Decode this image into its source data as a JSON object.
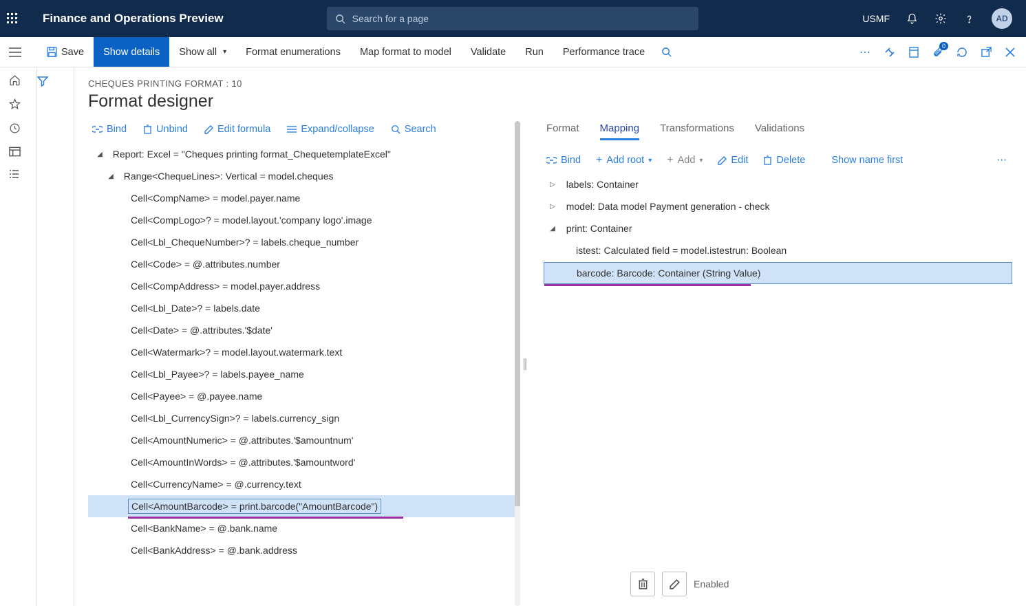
{
  "topbar": {
    "brand": "Finance and Operations Preview",
    "search_placeholder": "Search for a page",
    "entity": "USMF",
    "avatar": "AD"
  },
  "actions": {
    "save": "Save",
    "show_details": "Show details",
    "show_all": "Show all",
    "format_enum": "Format enumerations",
    "map_format": "Map format to model",
    "validate": "Validate",
    "run": "Run",
    "perf": "Performance trace",
    "badge": "0"
  },
  "page": {
    "breadcrumb": "CHEQUES PRINTING FORMAT : 10",
    "title": "Format designer"
  },
  "left_toolbar": {
    "bind": "Bind",
    "unbind": "Unbind",
    "edit_formula": "Edit formula",
    "expand": "Expand/collapse",
    "search": "Search"
  },
  "format_tree": {
    "root": "Report: Excel = \"Cheques printing format_ChequetemplateExcel\"",
    "range": "Range<ChequeLines>: Vertical = model.cheques",
    "cells": [
      "Cell<CompName> = model.payer.name",
      "Cell<CompLogo>? = model.layout.'company logo'.image",
      "Cell<Lbl_ChequeNumber>? = labels.cheque_number",
      "Cell<Code> = @.attributes.number",
      "Cell<CompAddress> = model.payer.address",
      "Cell<Lbl_Date>? = labels.date",
      "Cell<Date> = @.attributes.'$date'",
      "Cell<Watermark>? = model.layout.watermark.text",
      "Cell<Lbl_Payee>? = labels.payee_name",
      "Cell<Payee> = @.payee.name",
      "Cell<Lbl_CurrencySign>? = labels.currency_sign",
      "Cell<AmountNumeric> = @.attributes.'$amountnum'",
      "Cell<AmountInWords> = @.attributes.'$amountword'",
      "Cell<CurrencyName> = @.currency.text",
      "Cell<AmountBarcode> = print.barcode(\"AmountBarcode\")",
      "Cell<BankName> = @.bank.name",
      "Cell<BankAddress> = @.bank.address"
    ],
    "selected_index": 14
  },
  "tabs": {
    "format": "Format",
    "mapping": "Mapping",
    "transformations": "Transformations",
    "validations": "Validations",
    "active": "mapping"
  },
  "right_toolbar": {
    "bind": "Bind",
    "add_root": "Add root",
    "add": "Add",
    "edit": "Edit",
    "delete": "Delete",
    "show_name": "Show name first"
  },
  "mapping_tree": {
    "labels": "labels: Container",
    "model": "model: Data model Payment generation - check",
    "print": "print: Container",
    "istest": "istest: Calculated field = model.istestrun: Boolean",
    "barcode": "barcode: Barcode: Container (String Value)"
  },
  "footer": {
    "enabled": "Enabled"
  }
}
